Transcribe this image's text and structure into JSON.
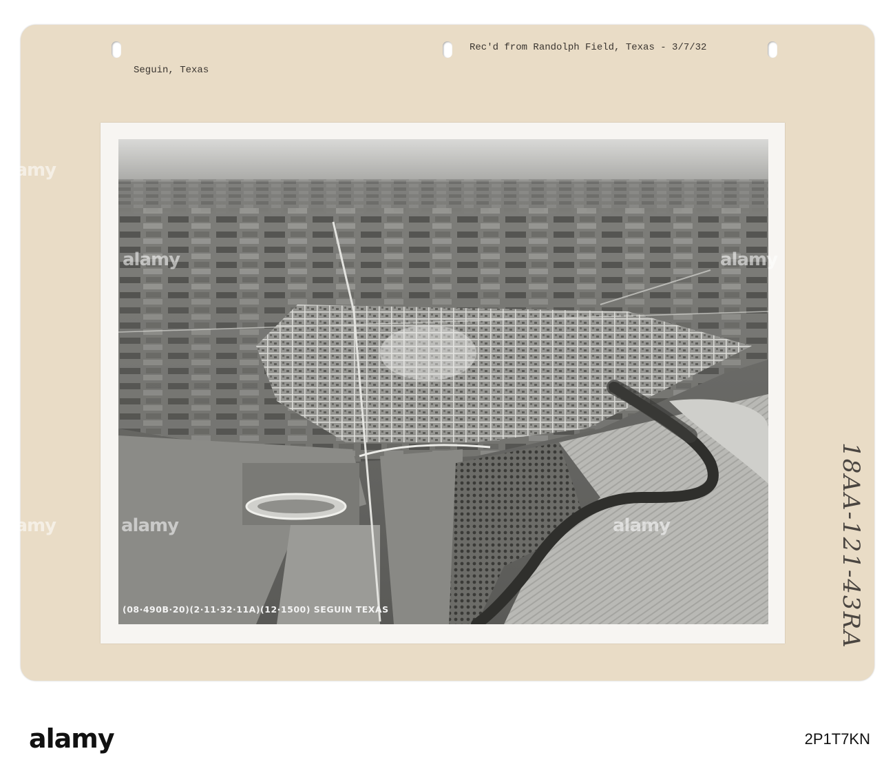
{
  "mount": {
    "location_label": "Seguin, Texas",
    "received_note": "Rec'd from Randolph Field, Texas - 3/7/32",
    "handwritten_number": "18AA-121-43RA"
  },
  "photo": {
    "caption": "(08·490B·20)(2·11·32·11A)(12·1500)   SEGUIN   TEXAS"
  },
  "footer": {
    "logo": "alamy",
    "stock_id": "2P1T7KN"
  },
  "watermark": {
    "text": "alamy"
  }
}
